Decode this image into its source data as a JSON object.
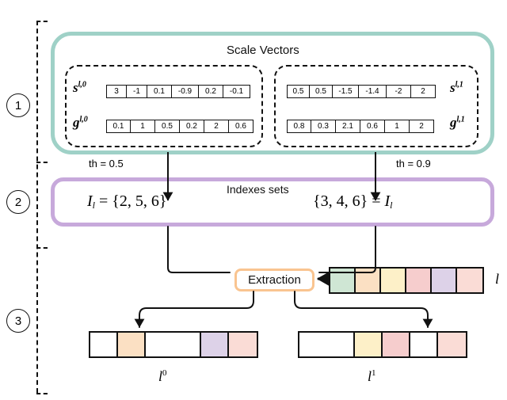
{
  "steps": [
    {
      "num": "1"
    },
    {
      "num": "2"
    },
    {
      "num": "3"
    }
  ],
  "section1": {
    "title": "Scale Vectors",
    "groups": [
      {
        "id": "left",
        "rows": [
          {
            "symbol": "s",
            "sup": "l,0",
            "label_side": "left",
            "values": [
              "3",
              "-1",
              "0.1",
              "-0.9",
              "0.2",
              "-0.1"
            ]
          },
          {
            "symbol": "g",
            "sup": "l,0",
            "label_side": "left",
            "values": [
              "0.1",
              "1",
              "0.5",
              "0.2",
              "2",
              "0.6"
            ]
          }
        ]
      },
      {
        "id": "right",
        "rows": [
          {
            "symbol": "s",
            "sup": "l,1",
            "label_side": "right",
            "values": [
              "0.5",
              "0.5",
              "-1.5",
              "-1.4",
              "-2",
              "2"
            ]
          },
          {
            "symbol": "g",
            "sup": "l,1",
            "label_side": "right",
            "values": [
              "0.8",
              "0.3",
              "2.1",
              "0.6",
              "1",
              "2"
            ]
          }
        ]
      }
    ]
  },
  "thresholds": {
    "left": "th = 0.5",
    "right": "th = 0.9"
  },
  "section2": {
    "title": "Indexes sets",
    "left_formula_symbol": "I",
    "left_formula_sub": "l",
    "left_formula_eq": "= {2, 5, 6}",
    "right_formula_set": "{3, 4, 6} =",
    "right_formula_symbol": "I",
    "right_formula_sub": "l"
  },
  "section3": {
    "extraction_label": "Extraction",
    "input_vector": {
      "name": "l",
      "colors": [
        "#cfe6d4",
        "#fbe0c3",
        "#fdf0c8",
        "#f6cdcd",
        "#ddd2e8",
        "#fadcd6"
      ]
    },
    "outputs": [
      {
        "name": "l",
        "sup": "0",
        "cells": [
          {
            "color": "#ffffff",
            "wide": false
          },
          {
            "color": "#fbe0c3",
            "wide": false
          },
          {
            "color": "#ffffff",
            "wide": true
          },
          {
            "color": "#ddd2e8",
            "wide": false
          },
          {
            "color": "#fadcd6",
            "wide": false
          }
        ]
      },
      {
        "name": "l",
        "sup": "1",
        "cells": [
          {
            "color": "#ffffff",
            "wide": true
          },
          {
            "color": "#fdf0c8",
            "wide": false
          },
          {
            "color": "#f6cdcd",
            "wide": false
          },
          {
            "color": "#ffffff",
            "wide": false
          },
          {
            "color": "#fadcd6",
            "wide": false
          }
        ]
      }
    ]
  },
  "colors": {
    "teal_border": "#9fd1c7",
    "purple_border": "#c7a9db",
    "orange_border": "#f9c490",
    "stroke": "#111111"
  }
}
